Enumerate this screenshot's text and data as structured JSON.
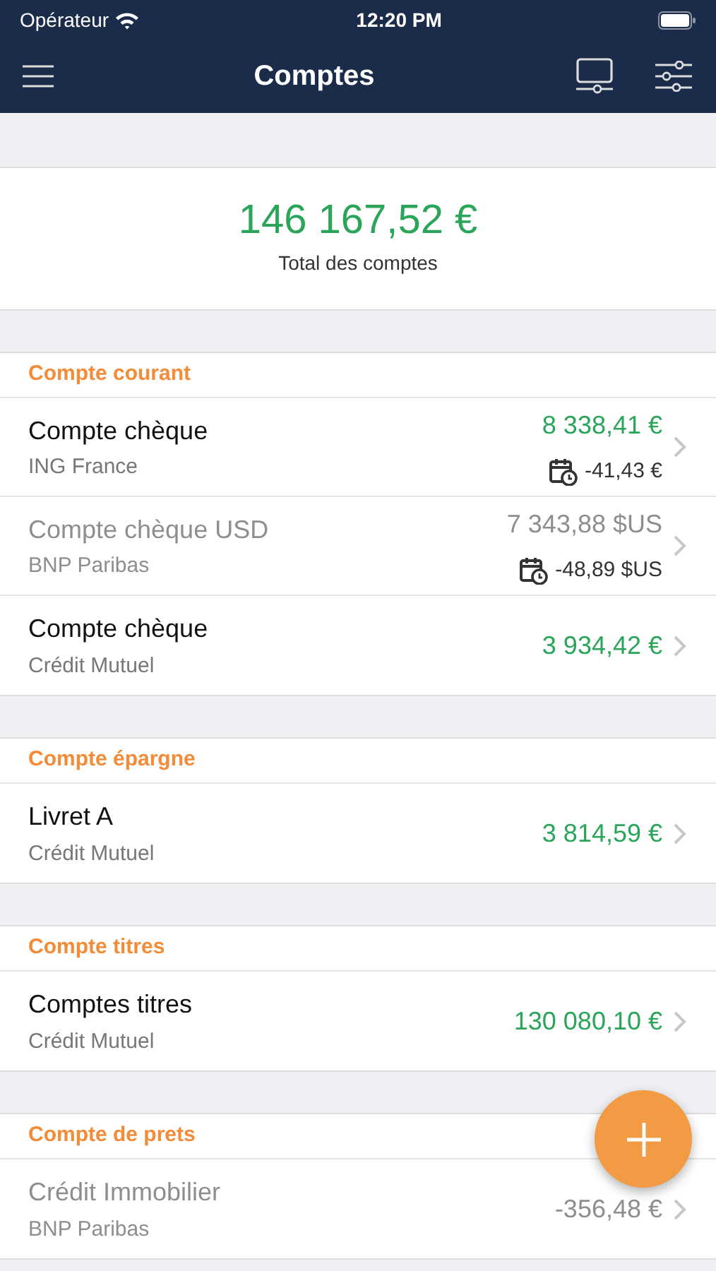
{
  "status_bar": {
    "carrier": "Opérateur",
    "time": "12:20 PM"
  },
  "nav": {
    "title": "Comptes"
  },
  "total": {
    "amount": "146 167,52 €",
    "label": "Total des comptes"
  },
  "sections": [
    {
      "title": "Compte courant",
      "accounts": [
        {
          "name": "Compte chèque",
          "bank": "ING France",
          "amount": "8 338,41 €",
          "pending": "-41,43 €",
          "disabled": false
        },
        {
          "name": "Compte chèque USD",
          "bank": "BNP Paribas",
          "amount": "7 343,88 $US",
          "pending": "-48,89 $US",
          "disabled": true
        },
        {
          "name": "Compte chèque",
          "bank": "Crédit Mutuel",
          "amount": "3 934,42 €",
          "disabled": false
        }
      ]
    },
    {
      "title": "Compte épargne",
      "accounts": [
        {
          "name": "Livret A",
          "bank": "Crédit Mutuel",
          "amount": "3 814,59 €",
          "disabled": false
        }
      ]
    },
    {
      "title": "Compte titres",
      "accounts": [
        {
          "name": "Comptes titres",
          "bank": "Crédit Mutuel",
          "amount": "130 080,10 €",
          "disabled": false
        }
      ]
    },
    {
      "title": "Compte de prets",
      "accounts": [
        {
          "name": "Crédit Immobilier",
          "bank": "BNP Paribas",
          "amount": "-356,48 €",
          "disabled": true
        }
      ]
    }
  ]
}
